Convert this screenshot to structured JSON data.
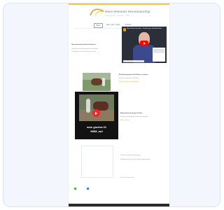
{
  "site": {
    "logo_text": "Henri Hemmer Horsemanship",
    "tagline": "Horsemanship · Coaching · Videos"
  },
  "nav": {
    "items": [
      {
        "label": "Home"
      },
      {
        "label": "Über mich / Kurse"
      },
      {
        "label": "Kontakt"
      }
    ]
  },
  "intro": {
    "heading": "Horsemanship nach Henri Hemmer",
    "line1": "Ruhige, klare Kommunikation mit Pferden",
    "line2": "Trainings, Kurse und Videos für Reiter"
  },
  "video1": {
    "title": "Natural Horsemanship – Einführung in die Bodenarbeit"
  },
  "section2": {
    "heading": "Die Körpersprache des Pferdes verstehen",
    "line1": "Vertrauen aufbauen am Boden",
    "line2": "Führen, Weichen und Respekt"
  },
  "video2": {
    "caption_line1": "solo giostra 01",
    "caption_line2": "HBM_auf"
  },
  "section3": {
    "heading": "Bodenarbeit mit jungen Pferden",
    "line1": "Übungen für Anfänger und Fortgeschrittene",
    "link": "Mehr erfahren"
  },
  "section4": {
    "line1": "Termine und Kurse auf Anfrage",
    "line2": "Kontaktieren Sie uns für weitere Informationen",
    "link": "Zum Kontaktformular"
  },
  "colors": {
    "accent": "#e0a21b",
    "youtube_red": "#ff0000",
    "footer": "#2b2b2b",
    "social_green": "#4caf50",
    "social_blue": "#3b82c4"
  }
}
